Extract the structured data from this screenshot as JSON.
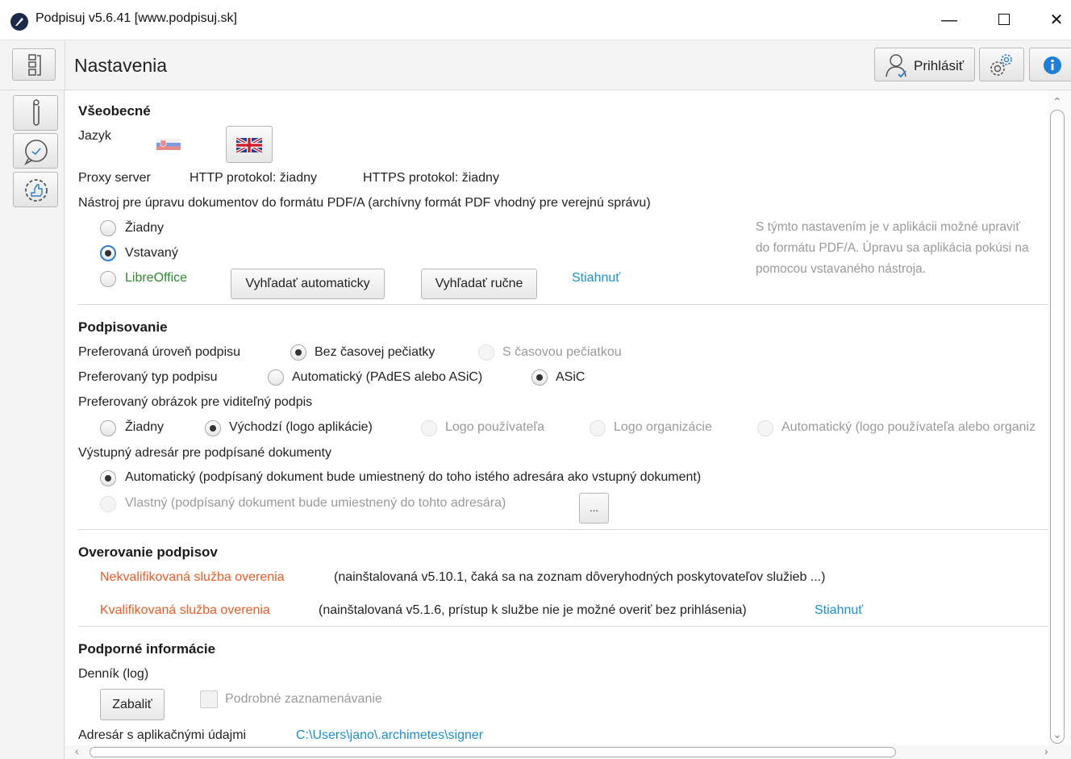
{
  "window": {
    "title": "Podpisuj v5.6.41 [www.podpisuj.sk]",
    "minimize": "—",
    "close": "✕"
  },
  "toolbar": {
    "page_title": "Nastavenia",
    "login_label": "Prihlásiť"
  },
  "general": {
    "heading": "Všeobecné",
    "language_label": "Jazyk",
    "proxy_label": "Proxy server",
    "http_proxy": "HTTP protokol: žiadny",
    "https_proxy": "HTTPS protokol: žiadny",
    "pdfa_label": "Nástroj pre úpravu dokumentov do formátu PDF/A (archívny formát PDF vhodný pre verejnú správu)",
    "pdfa_options": [
      "Žiadny",
      "Vstavaný",
      "LibreOffice"
    ],
    "pdfa_selected": "Vstavaný",
    "find_auto": "Vyhľadať automaticky",
    "find_manual": "Vyhľadať ručne",
    "download": "Stiahnuť",
    "pdfa_note_lines": [
      "S týmto nastavením je v aplikácii možné upraviť",
      "do formátu PDF/A. Úpravu sa aplikácia pokúsi na",
      "pomocou vstavaného nástroja."
    ]
  },
  "signing": {
    "heading": "Podpisovanie",
    "level_label": "Preferovaná úroveň podpisu",
    "level_options": [
      "Bez časovej pečiatky",
      "S časovou pečiatkou"
    ],
    "type_label": "Preferovaný typ podpisu",
    "type_options": [
      "Automatický (PAdES alebo ASiC)",
      "ASiC"
    ],
    "image_label": "Preferovaný obrázok pre viditeľný podpis",
    "image_options": [
      "Žiadny",
      "Východzí (logo aplikácie)",
      "Logo používateľa",
      "Logo organizácie",
      "Automatický (logo používateľa alebo organiz"
    ],
    "output_label": "Výstupný adresár pre podpísané dokumenty",
    "output_options": [
      "Automatický (podpísaný dokument bude umiestnený do toho istého adresára ako vstupný dokument)",
      "Vlastný (podpísaný dokument bude umiestnený do tohto adresára)"
    ],
    "browse_button": "..."
  },
  "verification": {
    "heading": "Overovanie podpisov",
    "unqualified_name": "Nekvalifikovaná služba overenia",
    "unqualified_status": "(nainštalovaná v5.10.1, čaká sa na zoznam dôveryhodných poskytovateľov služieb ...)",
    "qualified_name": "Kvalifikovaná služba overenia",
    "qualified_status": "(nainštalovaná v5.1.6, prístup k službe nie je možné overiť bez prihlásenia)",
    "download": "Stiahnuť"
  },
  "support": {
    "heading": "Podporné informácie",
    "log_label": "Denník (log)",
    "pack_button": "Zabaliť",
    "verbose_logging": "Podrobné zaznamenávanie",
    "app_dir_label": "Adresár s aplikačnými údajmi",
    "app_dir_path": "C:\\Users\\jano\\.archimetes\\signer"
  }
}
